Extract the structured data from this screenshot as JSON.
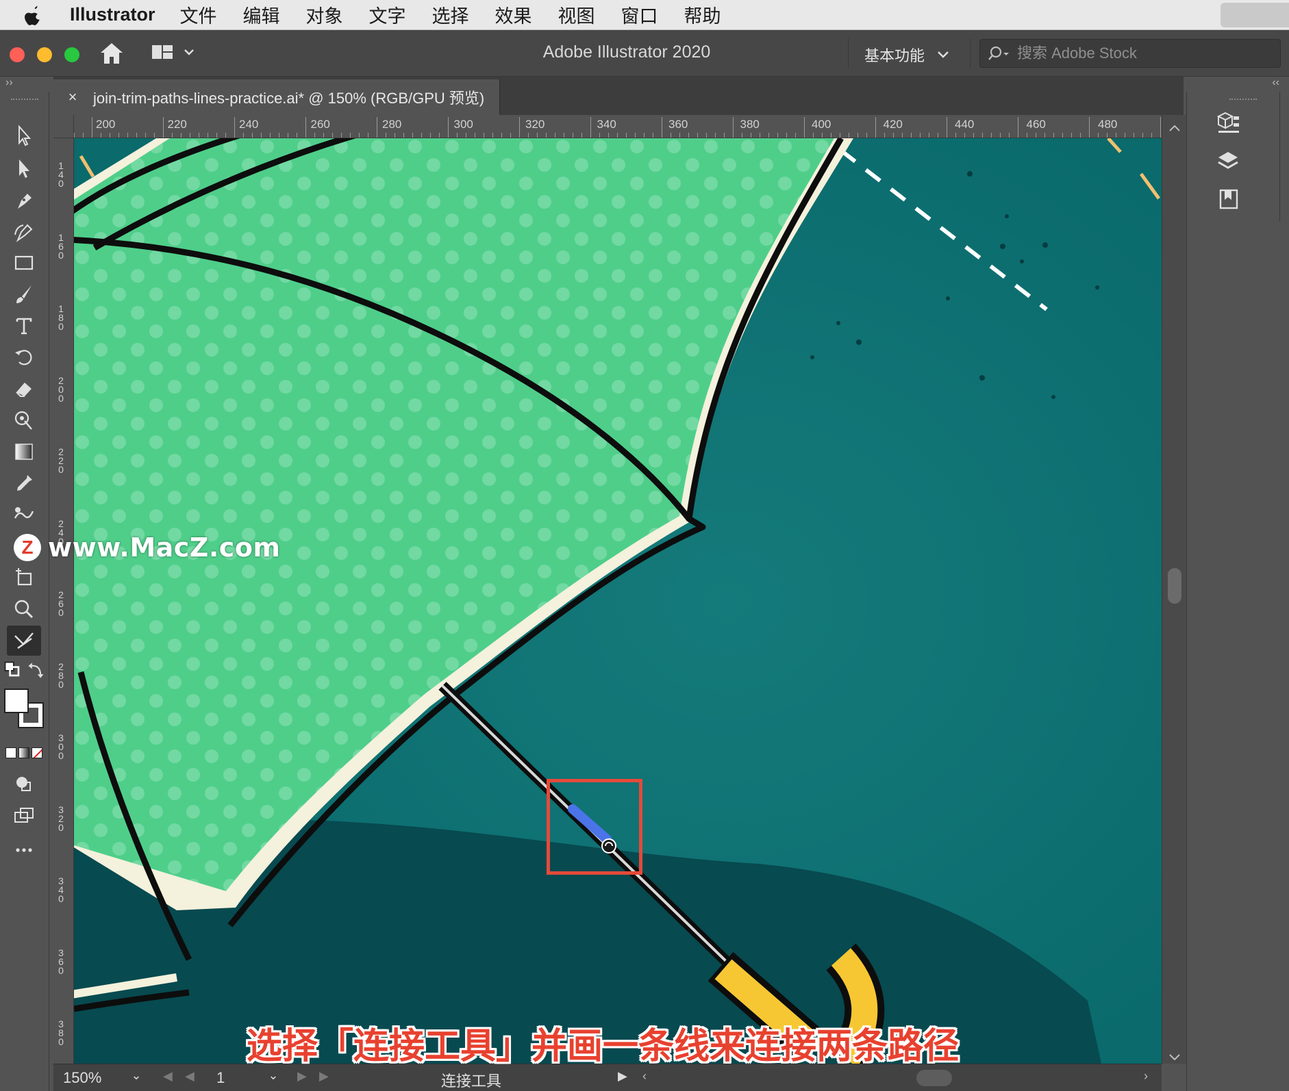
{
  "menubar": {
    "app_name": "Illustrator",
    "items": [
      "文件",
      "编辑",
      "对象",
      "文字",
      "选择",
      "效果",
      "视图",
      "窗口",
      "帮助"
    ]
  },
  "appbar": {
    "title": "Adobe Illustrator 2020",
    "workspace": "基本功能",
    "stock_placeholder": "搜索 Adobe Stock"
  },
  "document": {
    "tab_title": "join-trim-paths-lines-practice.ai* @ 150% (RGB/GPU 预览)",
    "close_glyph": "×"
  },
  "rulers": {
    "top_labels": [
      "200",
      "220",
      "240",
      "260",
      "280",
      "300",
      "320",
      "340",
      "360",
      "380",
      "400",
      "420",
      "440",
      "460",
      "480"
    ],
    "left_labels": [
      "140",
      "160",
      "180",
      "200",
      "220",
      "240",
      "260",
      "280",
      "300",
      "320",
      "340",
      "360",
      "380"
    ]
  },
  "tools": [
    {
      "name": "selection-tool-icon"
    },
    {
      "name": "direct-selection-tool-icon"
    },
    {
      "name": "pen-tool-icon"
    },
    {
      "name": "curvature-tool-icon"
    },
    {
      "name": "rectangle-tool-icon"
    },
    {
      "name": "paintbrush-tool-icon"
    },
    {
      "name": "type-tool-icon"
    },
    {
      "name": "rotate-tool-icon"
    },
    {
      "name": "eraser-tool-icon"
    },
    {
      "name": "puppet-warp-tool-icon"
    },
    {
      "name": "gradient-tool-icon"
    },
    {
      "name": "eyedropper-tool-icon"
    },
    {
      "name": "blend-tool-icon"
    },
    {
      "name": "symbol-sprayer-tool-icon"
    },
    {
      "name": "artboard-tool-icon"
    },
    {
      "name": "zoom-tool-icon"
    },
    {
      "name": "join-tool-icon",
      "active": true
    }
  ],
  "statusbar": {
    "zoom": "150%",
    "page": "1",
    "current_tool": "连接工具"
  },
  "overlay": {
    "watermark": "www.MacZ.com",
    "watermark_logo": "Z",
    "caption": "选择「连接工具」并画一条线来连接两条路径"
  },
  "colors": {
    "canvas_teal": "#0a6a6c",
    "umbrella_green": "#4fce8a",
    "cream": "#f4f1dc",
    "handle_yellow": "#f7c733",
    "highlight_red": "#e44a3a",
    "join_stroke_blue": "#4a74e8"
  }
}
